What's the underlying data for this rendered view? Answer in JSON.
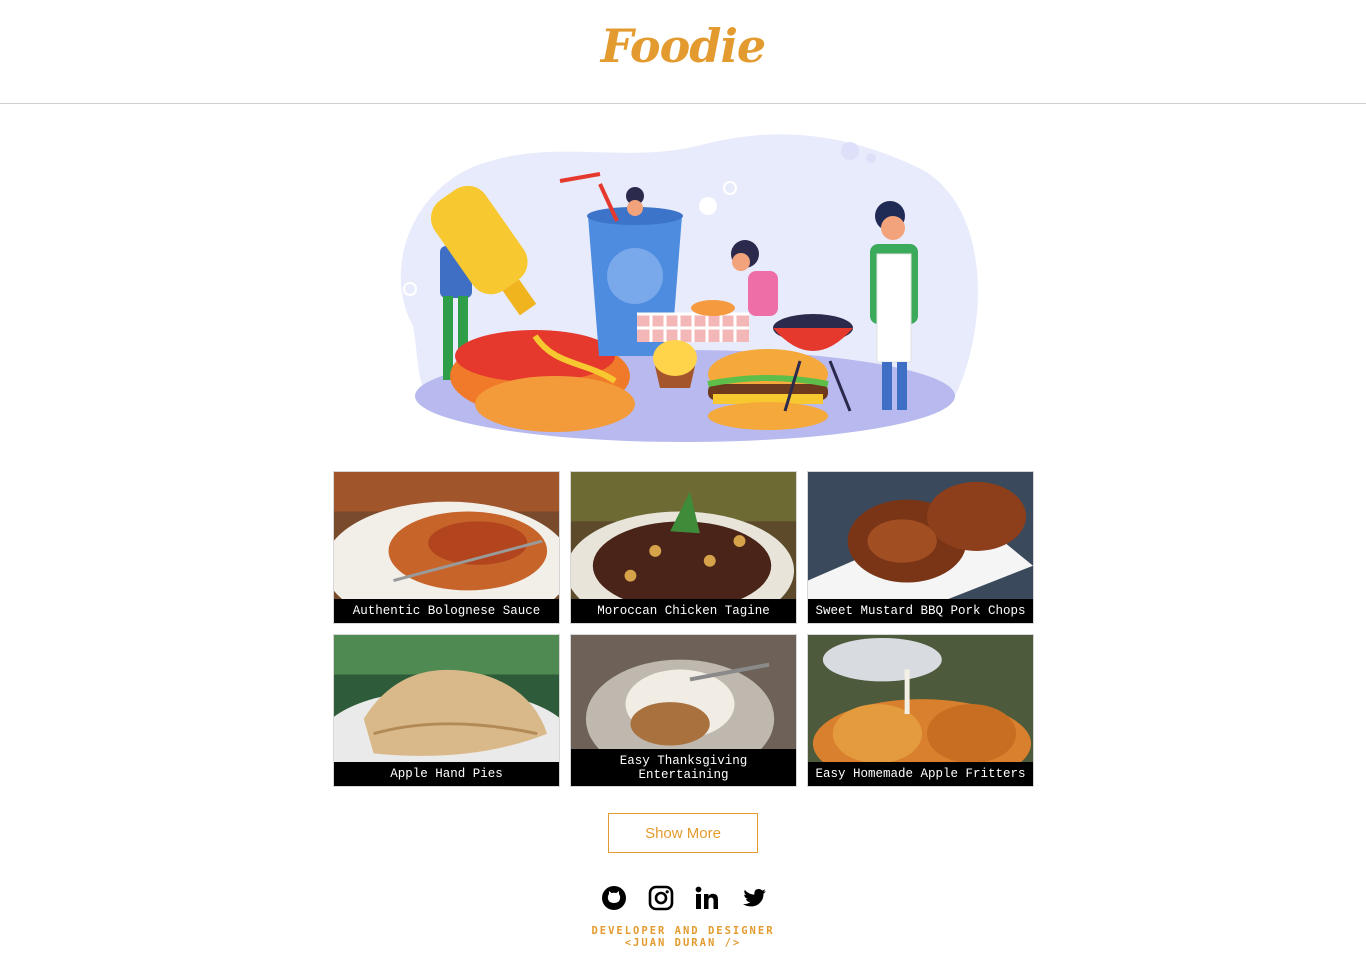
{
  "header": {
    "logo_text": "Foodie"
  },
  "hero": {
    "illustration": "food-party-illustration"
  },
  "recipes": [
    {
      "title": "Authentic Bolognese Sauce",
      "photo": "spaghetti-bolognese"
    },
    {
      "title": "Moroccan Chicken Tagine",
      "photo": "chicken-tagine"
    },
    {
      "title": "Sweet Mustard BBQ Pork Chops",
      "photo": "bbq-pork-chops"
    },
    {
      "title": "Apple Hand Pies",
      "photo": "apple-hand-pies"
    },
    {
      "title": "Easy Thanksgiving Entertaining",
      "photo": "thanksgiving-dessert"
    },
    {
      "title": "Easy Homemade Apple Fritters",
      "photo": "apple-fritters"
    }
  ],
  "actions": {
    "show_more_label": "Show More"
  },
  "footer": {
    "social_icons": [
      "github-icon",
      "instagram-icon",
      "linkedin-icon",
      "twitter-icon"
    ],
    "credit_line1": "Developer and Designer",
    "credit_line2": "<Juan Duran />"
  },
  "colors": {
    "accent": "#E39B2F",
    "caption_bg": "#000000",
    "caption_text": "#FFFFFF",
    "divider": "#CFCFCF"
  }
}
